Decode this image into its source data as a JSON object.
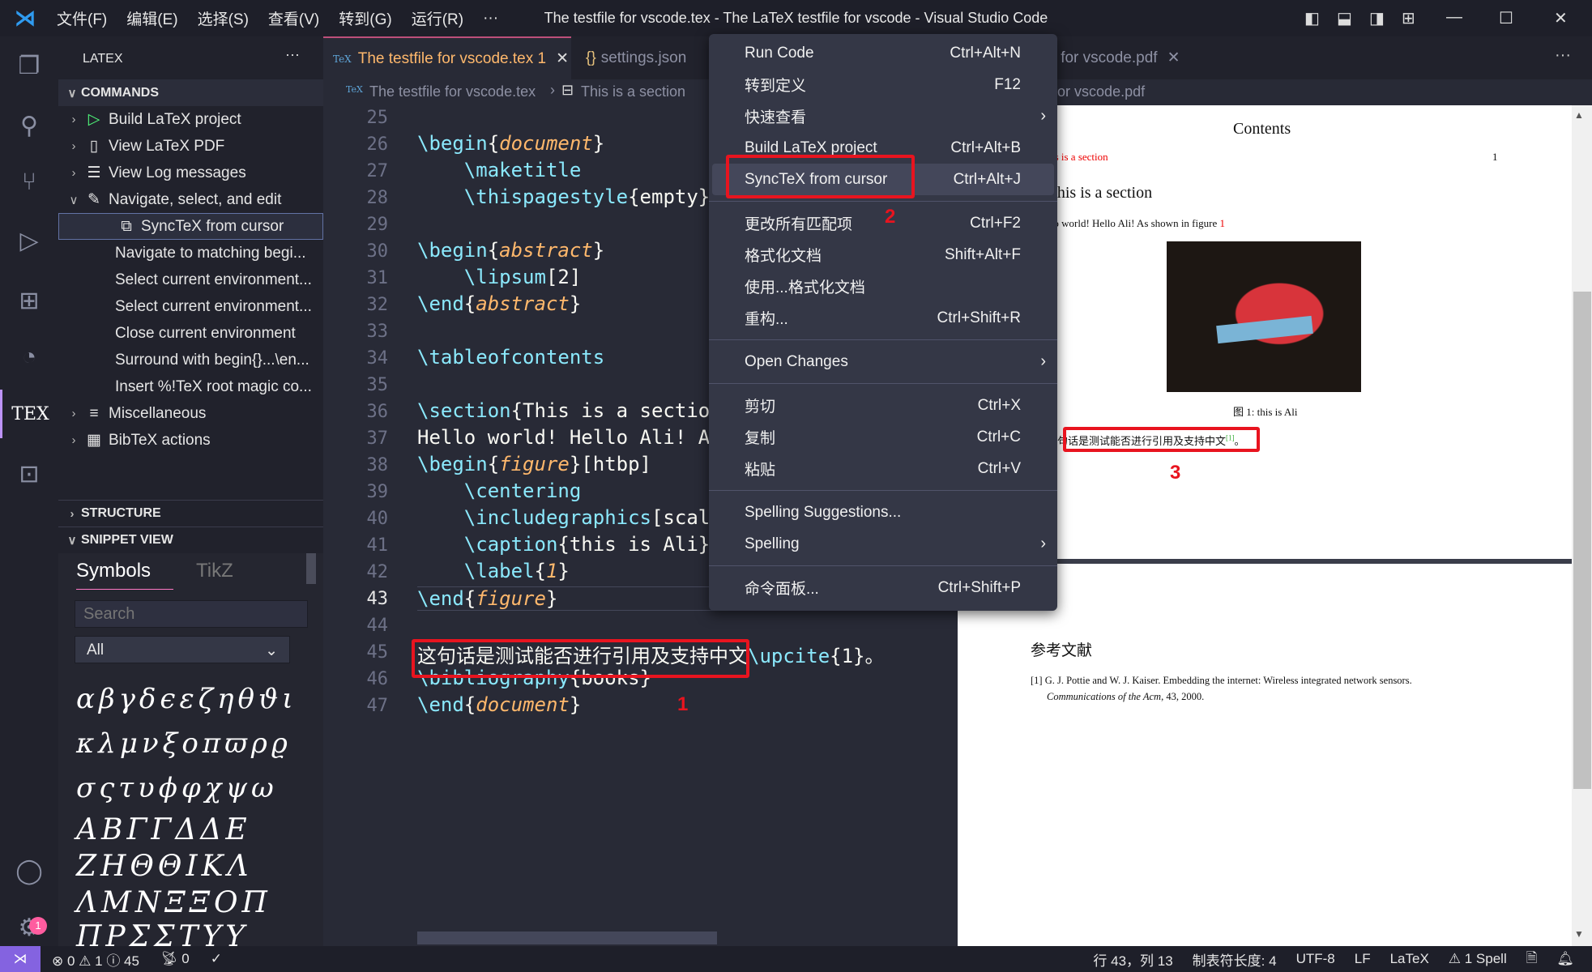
{
  "titlebar": {
    "menus": [
      "文件(F)",
      "编辑(E)",
      "选择(S)",
      "查看(V)",
      "转到(G)",
      "运行(R)",
      "···"
    ],
    "title": "The testfile for vscode.tex - The LaTeX testfile for vscode - Visual Studio Code"
  },
  "sidebar": {
    "title": "LATEX",
    "more": "···",
    "commands_header": "COMMANDS",
    "items": [
      {
        "label": "Build LaTeX project",
        "icon": "play-icon"
      },
      {
        "label": "View LaTeX PDF",
        "icon": "pdf-icon"
      },
      {
        "label": "View Log messages",
        "icon": "log-icon"
      },
      {
        "label": "Navigate, select, and edit",
        "icon": "edit-icon"
      },
      {
        "label": "SyncTeX from cursor",
        "icon": "sync-icon"
      },
      {
        "label": "Navigate to matching begi..."
      },
      {
        "label": "Select current environment..."
      },
      {
        "label": "Select current environment..."
      },
      {
        "label": "Close current environment"
      },
      {
        "label": "Surround with begin{}...\\en..."
      },
      {
        "label": "Insert %!TeX root magic co..."
      },
      {
        "label": "Miscellaneous",
        "icon": "menu-icon"
      },
      {
        "label": "BibTeX actions",
        "icon": "bib-icon"
      }
    ],
    "structure_header": "STRUCTURE",
    "snippet_header": "SNIPPET VIEW",
    "snippet": {
      "tabs": [
        "Symbols",
        "TikZ"
      ],
      "search_placeholder": "Search",
      "filter": "All",
      "symbol_rows": [
        "αβγδϵεζηθϑι",
        "κλμνξοπϖρϱ",
        "σςτυϕφχψω",
        "ΑΒΓΓΔΔΕ",
        "ΖΗΘΘΙΚΛ",
        "ΛΜΝΞΞΟΠ",
        "ΠΡΣΣΤΥΥ"
      ]
    }
  },
  "tabs": [
    {
      "label": "The testfile for vscode.tex 1",
      "icon": "TeX"
    },
    {
      "label": "settings.json",
      "icon": "{}"
    },
    {
      "label": "The testfile for vscode.pdf"
    }
  ],
  "breadcrumb": {
    "file": "The testfile for vscode.tex",
    "section": "This is a section",
    "pdf": "The testfile for vscode.pdf"
  },
  "editor": {
    "current_line": 43,
    "lines": [
      {
        "n": 25,
        "t": []
      },
      {
        "n": 26,
        "t": [
          [
            "\\begin",
            "cmd"
          ],
          [
            "{",
            ""
          ],
          [
            "document",
            "arg"
          ],
          [
            "}",
            ""
          ]
        ]
      },
      {
        "n": 27,
        "t": [
          [
            "    ",
            ""
          ],
          [
            "\\maketitle",
            "cmd"
          ]
        ]
      },
      {
        "n": 28,
        "t": [
          [
            "    ",
            ""
          ],
          [
            "\\thispagestyle",
            "cmd"
          ],
          [
            "{empty}",
            ""
          ]
        ]
      },
      {
        "n": 29,
        "t": []
      },
      {
        "n": 30,
        "t": [
          [
            "\\begin",
            "cmd"
          ],
          [
            "{",
            ""
          ],
          [
            "abstract",
            "arg"
          ],
          [
            "}",
            ""
          ]
        ]
      },
      {
        "n": 31,
        "t": [
          [
            "    ",
            ""
          ],
          [
            "\\lipsum",
            "cmd"
          ],
          [
            "[2]",
            ""
          ]
        ]
      },
      {
        "n": 32,
        "t": [
          [
            "\\end",
            "cmd"
          ],
          [
            "{",
            ""
          ],
          [
            "abstract",
            "arg"
          ],
          [
            "}",
            ""
          ]
        ]
      },
      {
        "n": 33,
        "t": []
      },
      {
        "n": 34,
        "t": [
          [
            "\\tableofcontents",
            "cmd"
          ]
        ]
      },
      {
        "n": 35,
        "t": []
      },
      {
        "n": 36,
        "t": [
          [
            "\\section",
            "cmd"
          ],
          [
            "{This is a sectio",
            ""
          ]
        ]
      },
      {
        "n": 37,
        "t": [
          [
            "Hello world! Hello Ali! A",
            ""
          ]
        ]
      },
      {
        "n": 38,
        "t": [
          [
            "\\begin",
            "cmd"
          ],
          [
            "{",
            ""
          ],
          [
            "figure",
            "arg"
          ],
          [
            "}[htbp]",
            ""
          ]
        ]
      },
      {
        "n": 39,
        "t": [
          [
            "    ",
            ""
          ],
          [
            "\\centering",
            "cmd"
          ]
        ]
      },
      {
        "n": 40,
        "t": [
          [
            "    ",
            ""
          ],
          [
            "\\includegraphics",
            "cmd"
          ],
          [
            "[scal",
            ""
          ]
        ]
      },
      {
        "n": 41,
        "t": [
          [
            "    ",
            ""
          ],
          [
            "\\caption",
            "cmd"
          ],
          [
            "{this is Ali}",
            ""
          ]
        ]
      },
      {
        "n": 42,
        "t": [
          [
            "    ",
            ""
          ],
          [
            "\\label",
            "cmd"
          ],
          [
            "{",
            ""
          ],
          [
            "1",
            "arg"
          ],
          [
            "}",
            ""
          ]
        ]
      },
      {
        "n": 43,
        "t": [
          [
            "\\end",
            "cmd"
          ],
          [
            "{",
            ""
          ],
          [
            "figure",
            "arg"
          ],
          [
            "}",
            ""
          ]
        ]
      },
      {
        "n": 44,
        "t": []
      },
      {
        "n": 45,
        "t": [
          [
            "这句话是测试能否进行引用及支持中文",
            ""
          ],
          [
            "\\upcite",
            "cmd"
          ],
          [
            "{1}。",
            ""
          ]
        ]
      },
      {
        "n": 46,
        "t": [
          [
            "\\bibliography",
            "cmd"
          ],
          [
            "{books}",
            ""
          ]
        ]
      },
      {
        "n": 47,
        "t": [
          [
            "\\end",
            "cmd"
          ],
          [
            "{",
            ""
          ],
          [
            "document",
            "arg"
          ],
          [
            "}",
            ""
          ]
        ]
      }
    ]
  },
  "context_menu": {
    "groups": [
      [
        {
          "label": "Run Code",
          "key": "Ctrl+Alt+N"
        },
        {
          "label": "转到定义",
          "key": "F12"
        },
        {
          "label": "快速查看",
          "key": "",
          "submenu": true
        },
        {
          "label": "Build LaTeX project",
          "key": "Ctrl+Alt+B"
        },
        {
          "label": "SyncTeX from cursor",
          "key": "Ctrl+Alt+J",
          "highlight": true
        }
      ],
      [
        {
          "label": "更改所有匹配项",
          "key": "Ctrl+F2"
        },
        {
          "label": "格式化文档",
          "key": "Shift+Alt+F"
        },
        {
          "label": "使用...格式化文档",
          "key": ""
        },
        {
          "label": "重构...",
          "key": "Ctrl+Shift+R"
        }
      ],
      [
        {
          "label": "Open Changes",
          "key": "",
          "submenu": true
        }
      ],
      [
        {
          "label": "剪切",
          "key": "Ctrl+X"
        },
        {
          "label": "复制",
          "key": "Ctrl+C"
        },
        {
          "label": "粘贴",
          "key": "Ctrl+V"
        }
      ],
      [
        {
          "label": "Spelling Suggestions...",
          "key": ""
        },
        {
          "label": "Spelling",
          "key": "",
          "submenu": true
        }
      ],
      [
        {
          "label": "命令面板...",
          "key": "Ctrl+Shift+P"
        }
      ]
    ]
  },
  "pdf": {
    "contents_title": "Contents",
    "toc_entry": "1 This is a section",
    "toc_page": "1",
    "section_heading": "1 This is a section",
    "body": "Hello world! Hello Ali! As shown in figure ",
    "fig_ref": "1",
    "caption": "图 1: this is Ali",
    "chinese": "这句话是测试能否进行引用及支持中文",
    "cite": "[1]",
    "period": "。",
    "bib_title": "参考文献",
    "bib_num": "[1]",
    "bib_line1": "G. J. Pottie and W. J. Kaiser.  Embedding the internet:  Wireless integrated network sensors.",
    "bib_journal": "Communications of the Acm",
    "bib_rest": ", 43, 2000."
  },
  "annotations": [
    "1",
    "2",
    "3"
  ],
  "status": {
    "errors": "0",
    "warnings": "1",
    "info": "45",
    "ports": "0",
    "position": "行 43，列 13",
    "tab_size": "制表符长度: 4",
    "encoding": "UTF-8",
    "eol": "LF",
    "language": "LaTeX",
    "spell": "1 Spell"
  },
  "colors": {
    "accent": "#bd93f9",
    "annotation": "#e8141f",
    "command": "#8be9fd",
    "argument": "#ffb86c"
  }
}
